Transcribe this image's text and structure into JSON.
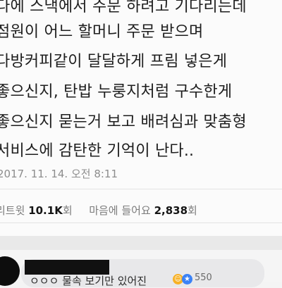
{
  "tweet": {
    "lines": [
      "다에 스낵에서 주문 하려고 기다리는데",
      "점원이 어느 할머니 주문 받으며",
      "다방커피같이 달달하게 프림 넣은게",
      "좋으신지, 탄밥 누룽지처럼 구수한게",
      "좋으신지 묻는거 보고 배려심과 맞춤형",
      "서비스에 감탄한 기억이 난다.."
    ],
    "timestamp": "2017. 11. 14. 오전 8:11",
    "stats": {
      "retweet_label": "리트윗",
      "retweet_count": "10.1K",
      "retweet_unit": "회",
      "like_label": "마음에 들어요",
      "like_count": "2,838",
      "like_unit": "회"
    }
  },
  "comment": {
    "text": "ㅇㅇㅇ 물속 보기만 있어진",
    "reaction_icons": [
      "haha-reaction-icon",
      "like-reaction-icon"
    ],
    "reaction_count": "550"
  }
}
